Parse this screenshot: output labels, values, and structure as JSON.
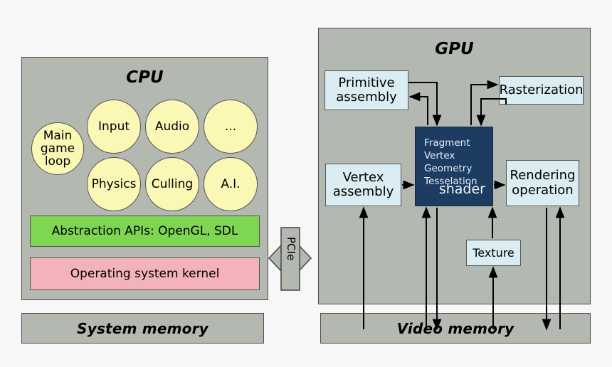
{
  "cpu": {
    "title": "CPU",
    "circles": [
      {
        "label": "Main\ngame\nloop"
      },
      {
        "label": "Input"
      },
      {
        "label": "Audio"
      },
      {
        "label": "..."
      },
      {
        "label": "Physics"
      },
      {
        "label": "Culling"
      },
      {
        "label": "A.I."
      }
    ],
    "bars": [
      {
        "label": "Abstraction APIs: OpenGL, SDL",
        "color": "#7ed653"
      },
      {
        "label": "Operating system kernel",
        "color": "#f4b3bb"
      }
    ]
  },
  "gpu": {
    "title": "GPU",
    "boxes": [
      {
        "label": "Primitive\nassembly"
      },
      {
        "label": "Rasterization"
      },
      {
        "label": "Vertex\nassembly"
      },
      {
        "label": "Rendering\noperation"
      },
      {
        "label": "Texture"
      }
    ],
    "shader": {
      "stages": "Fragment\nVertex\nGeometry\nTesselation",
      "word": "shader",
      "color": "#1d3c62"
    }
  },
  "memory": {
    "system": "System memory",
    "video": "Video memory"
  },
  "bus": {
    "label": "PCIe"
  },
  "colors": {
    "panel": "#b3b8b0",
    "gpu_box": "#d9edf3",
    "circle": "#fbf7b5",
    "api": "#7ed653",
    "kernel": "#f4b3bb",
    "shader": "#1d3c62",
    "stroke": "#4d4d4d"
  }
}
